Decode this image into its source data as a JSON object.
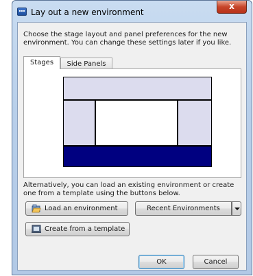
{
  "window": {
    "title": "Lay out a new environment",
    "close_glyph": "x"
  },
  "intro": {
    "text": "Choose the stage layout and panel preferences for the new environment. You can change these settings later if you like."
  },
  "tabs": [
    {
      "label": "Stages",
      "active": true
    },
    {
      "label": "Side Panels",
      "active": false
    }
  ],
  "stage_layout": {
    "colors": {
      "outline": "#000000",
      "panel": "#dcdcee",
      "stage": "#ffffff",
      "bottom": "#000080"
    }
  },
  "alternative": {
    "text": "Alternatively, you can load an existing environment or create one from a template using the buttons below."
  },
  "buttons": {
    "load": "Load an environment",
    "recent": "Recent Environments",
    "template": "Create from a template",
    "ok": "OK",
    "cancel": "Cancel"
  },
  "icons": {
    "load": "folder-open-icon",
    "template": "template-icon"
  },
  "colors": {
    "titlebar": "#b8cfea",
    "close_button": "#c7452a",
    "dialog_bg": "#f0f0f0",
    "default_button_border": "#3c7fb1"
  }
}
